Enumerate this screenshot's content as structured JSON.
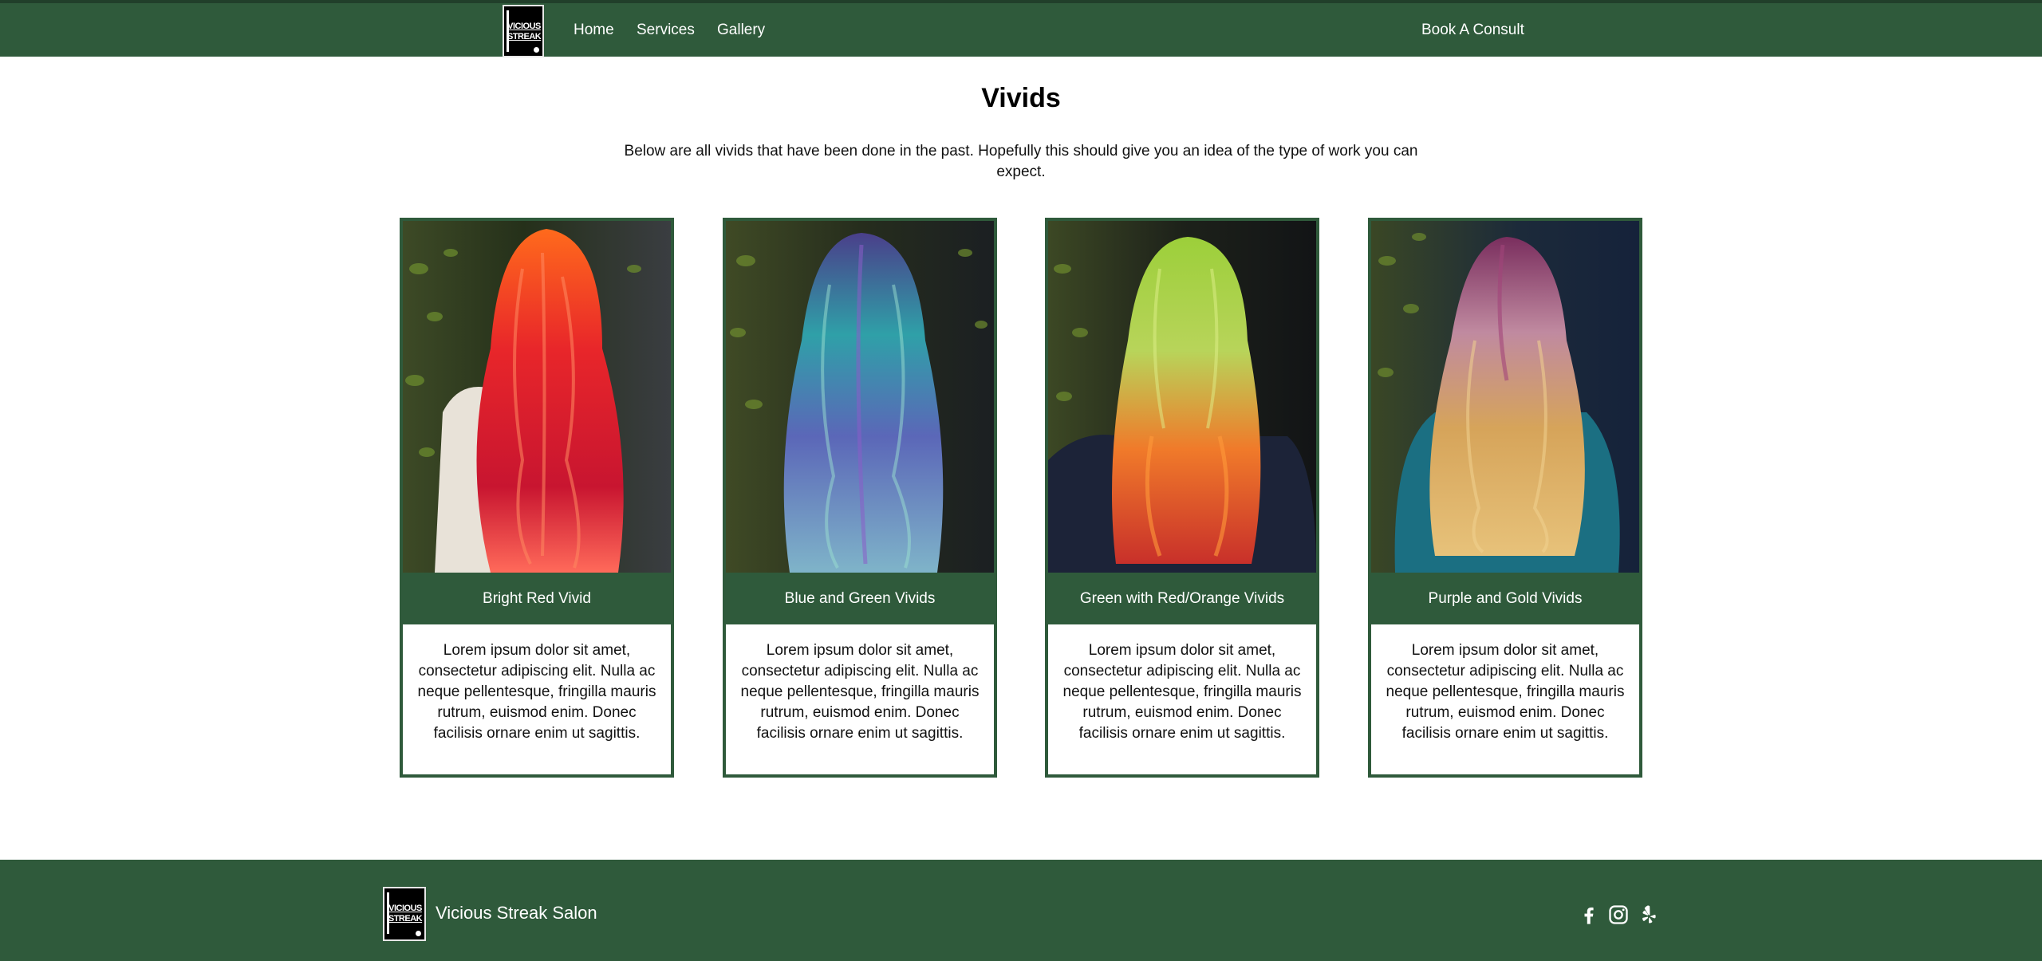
{
  "header": {
    "logo_text_line1": "VICIOUS",
    "logo_text_line2": "STREAK",
    "nav": {
      "home": "Home",
      "services": "Services",
      "gallery": "Gallery",
      "book": "Book A Consult"
    }
  },
  "main": {
    "title": "Vivids",
    "intro": "Below are all vivids that have been done in the past. Hopefully this should give you an idea of the type of work you can expect.",
    "cards": [
      {
        "title": "Bright Red Vivid",
        "description": "Lorem ipsum dolor sit amet, consectetur adipiscing elit. Nulla ac neque pellentesque, fringilla mauris rutrum, euismod enim. Donec facilisis ornare enim ut sagittis."
      },
      {
        "title": "Blue and Green Vivids",
        "description": "Lorem ipsum dolor sit amet, consectetur adipiscing elit. Nulla ac neque pellentesque, fringilla mauris rutrum, euismod enim. Donec facilisis ornare enim ut sagittis."
      },
      {
        "title": "Green with Red/Orange Vivids",
        "description": "Lorem ipsum dolor sit amet, consectetur adipiscing elit. Nulla ac neque pellentesque, fringilla mauris rutrum, euismod enim. Donec facilisis ornare enim ut sagittis."
      },
      {
        "title": "Purple and Gold Vivids",
        "description": "Lorem ipsum dolor sit amet, consectetur adipiscing elit. Nulla ac neque pellentesque, fringilla mauris rutrum, euismod enim. Donec facilisis ornare enim ut sagittis."
      }
    ]
  },
  "footer": {
    "salon_name": "Vicious Streak Salon",
    "social_icons": [
      "facebook-icon",
      "instagram-icon",
      "yelp-icon"
    ]
  },
  "colors": {
    "brand_green": "#2f5a3b",
    "background": "#ffffff",
    "text": "#111111"
  }
}
